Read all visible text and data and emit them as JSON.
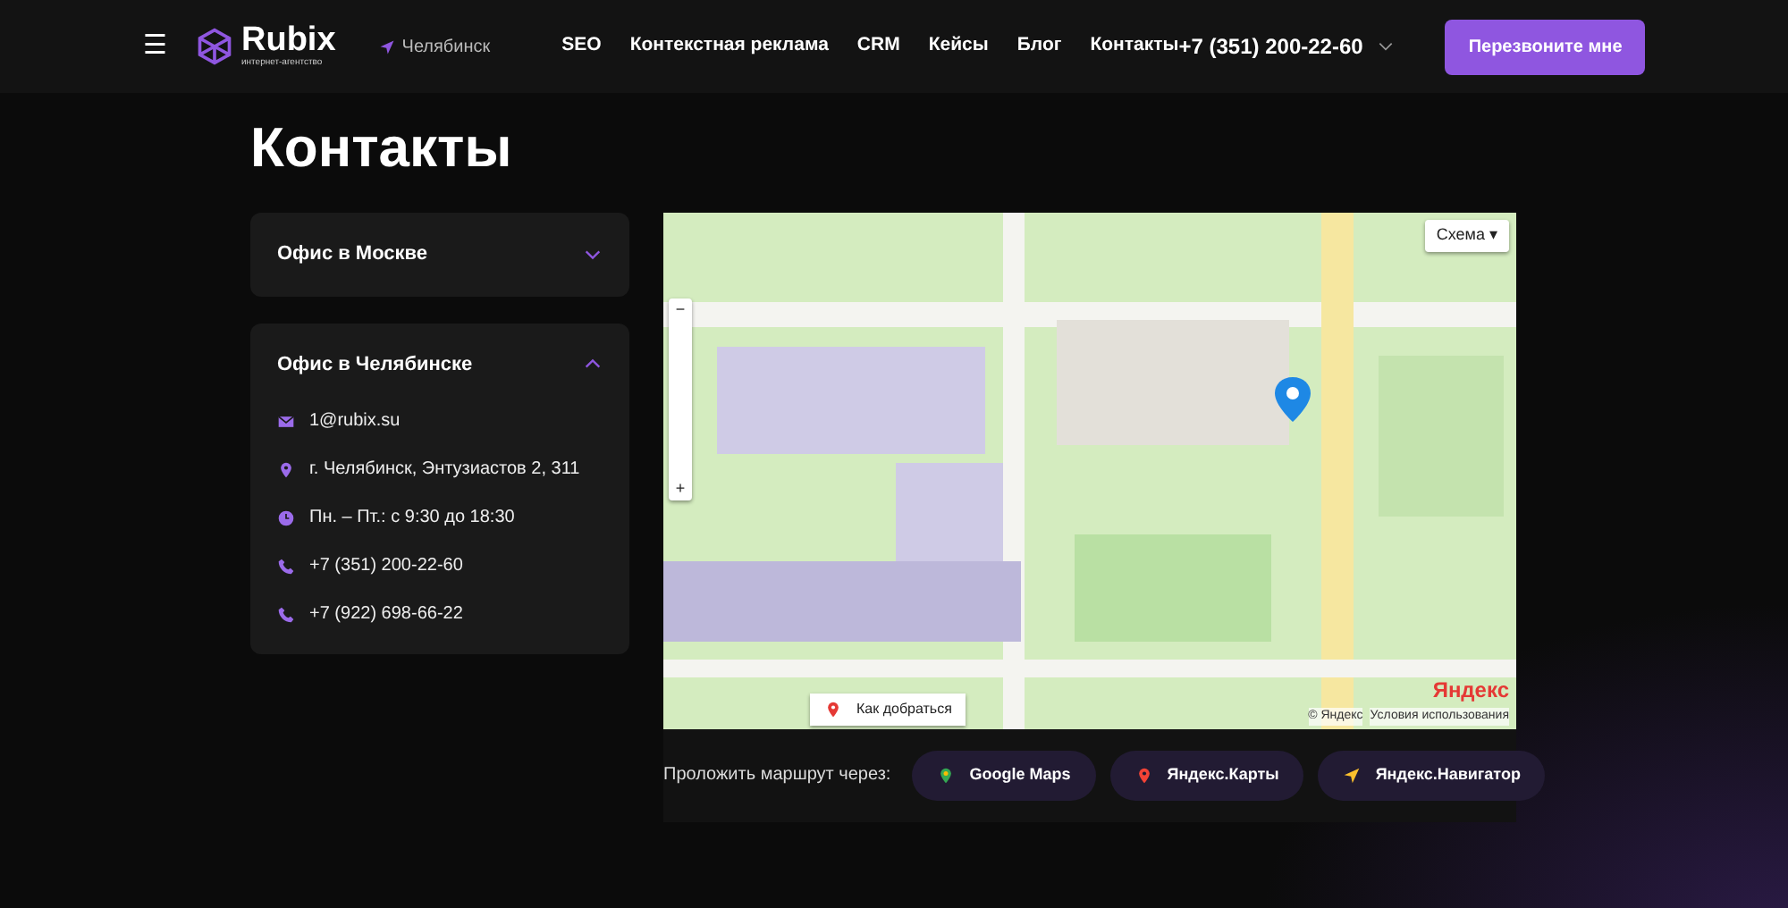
{
  "navbar": {
    "menu_icon": "☰",
    "logo": {
      "name": "Rubix",
      "tagline": "интернет-агентство"
    },
    "city": "Челябинск",
    "links": [
      {
        "label": "SEO",
        "selected": false
      },
      {
        "label": "Контекстная реклама",
        "selected": false
      },
      {
        "label": "CRM",
        "selected": false
      },
      {
        "label": "Кейсы",
        "selected": false
      },
      {
        "label": "Блог",
        "selected": false
      },
      {
        "label": "Контакты",
        "selected": false
      }
    ],
    "phone": "+7 (351) 200-22-60",
    "callback_button": "Перезвоните мне"
  },
  "page_title": "Контакты",
  "offices": [
    {
      "title": "Офис в Москве",
      "expanded": false
    },
    {
      "title": "Офис в Челябинске",
      "expanded": true,
      "contacts": [
        {
          "kind": "email",
          "text": "1@rubix.su"
        },
        {
          "kind": "address",
          "text": "г. Челябинск, Энтузиастов 2, 311"
        },
        {
          "kind": "hours",
          "text": "Пн. – Пт.: с 9:30 до 18:30"
        },
        {
          "kind": "phone",
          "text": "+7 (351) 200-22-60"
        },
        {
          "kind": "phone",
          "text": "+7 (922) 698-66-22"
        }
      ]
    }
  ],
  "map": {
    "layer_button": "Схема ▾",
    "zoom_in": "+",
    "zoom_out": "−",
    "route_button": "Как добраться",
    "copyright": "© Яндекс",
    "terms": "Условия использования",
    "logo": "Яндекс"
  },
  "route": {
    "label": "Проложить маршрут через:",
    "buttons": [
      {
        "kind": "google",
        "label": "Google Maps"
      },
      {
        "kind": "yandex",
        "label": "Яндекс.Карты"
      },
      {
        "kind": "navigator",
        "label": "Яндекс.Навигатор"
      }
    ]
  }
}
